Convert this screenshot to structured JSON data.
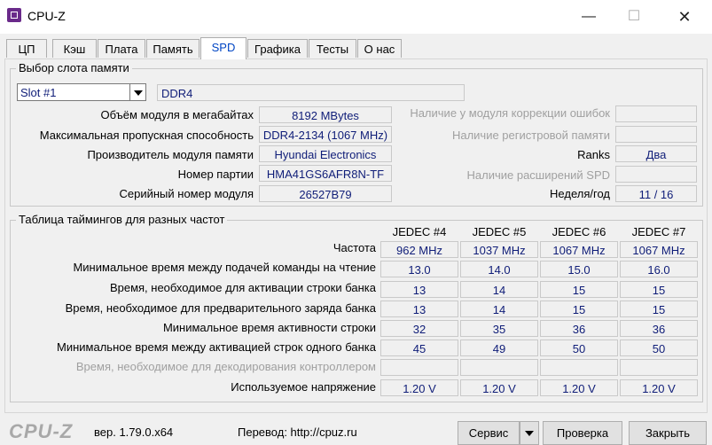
{
  "window": {
    "title": "CPU-Z",
    "min": "—",
    "max": "☐",
    "close": "✕"
  },
  "tabs": [
    "ЦП",
    "Кэш",
    "Плата",
    "Память",
    "SPD",
    "Графика",
    "Тесты",
    "О нас"
  ],
  "active_tab": "SPD",
  "slot_group": {
    "title": "Выбор слота памяти",
    "slot_select": "Slot #1",
    "type": "DDR4",
    "rows": [
      {
        "label": "Объём модуля в мегабайтах",
        "value": "8192 MBytes"
      },
      {
        "label": "Максимальная пропускная способность",
        "value": "DDR4-2134 (1067 MHz)"
      },
      {
        "label": "Производитель модуля памяти",
        "value": "Hyundai Electronics"
      },
      {
        "label": "Номер партии",
        "value": "HMA41GS6AFR8N-TF"
      },
      {
        "label": "Серийный номер модуля",
        "value": "26527B79"
      }
    ],
    "right_rows": [
      {
        "label": "Наличие у модуля коррекции ошибок",
        "value": ""
      },
      {
        "label": "Наличие регистровой памяти",
        "value": ""
      },
      {
        "label": "Ranks",
        "value": "Два"
      },
      {
        "label": "Наличие расширений SPD",
        "value": ""
      },
      {
        "label": "Неделя/год",
        "value": "11 / 16"
      }
    ]
  },
  "timing_group": {
    "title": "Таблица таймингов для разных частот",
    "columns": [
      "JEDEC #4",
      "JEDEC #5",
      "JEDEC #6",
      "JEDEC #7"
    ],
    "rows": [
      {
        "label": "Частота",
        "values": [
          "962 MHz",
          "1037 MHz",
          "1067 MHz",
          "1067 MHz"
        ]
      },
      {
        "label": "Минимальное время между подачей команды на чтение",
        "values": [
          "13.0",
          "14.0",
          "15.0",
          "16.0"
        ]
      },
      {
        "label": "Время, необходимое для активации строки банка",
        "values": [
          "13",
          "14",
          "15",
          "15"
        ]
      },
      {
        "label": "Время, необходимое для предварительного заряда банка",
        "values": [
          "13",
          "14",
          "15",
          "15"
        ]
      },
      {
        "label": "Минимальное время активности строки",
        "values": [
          "32",
          "35",
          "36",
          "36"
        ]
      },
      {
        "label": "Минимальное время между активацией строк одного банка",
        "values": [
          "45",
          "49",
          "50",
          "50"
        ]
      },
      {
        "label": "Время, необходимое для декодирования контроллером",
        "values": [
          "",
          "",
          "",
          ""
        ]
      },
      {
        "label": "Используемое напряжение",
        "values": [
          "1.20 V",
          "1.20 V",
          "1.20 V",
          "1.20 V"
        ]
      }
    ]
  },
  "footer": {
    "logo": "CPU-Z",
    "version": "вер. 1.79.0.x64",
    "translation": "Перевод: http://cpuz.ru",
    "service_button": "Сервис",
    "validate_button": "Проверка",
    "close_button": "Закрыть"
  }
}
